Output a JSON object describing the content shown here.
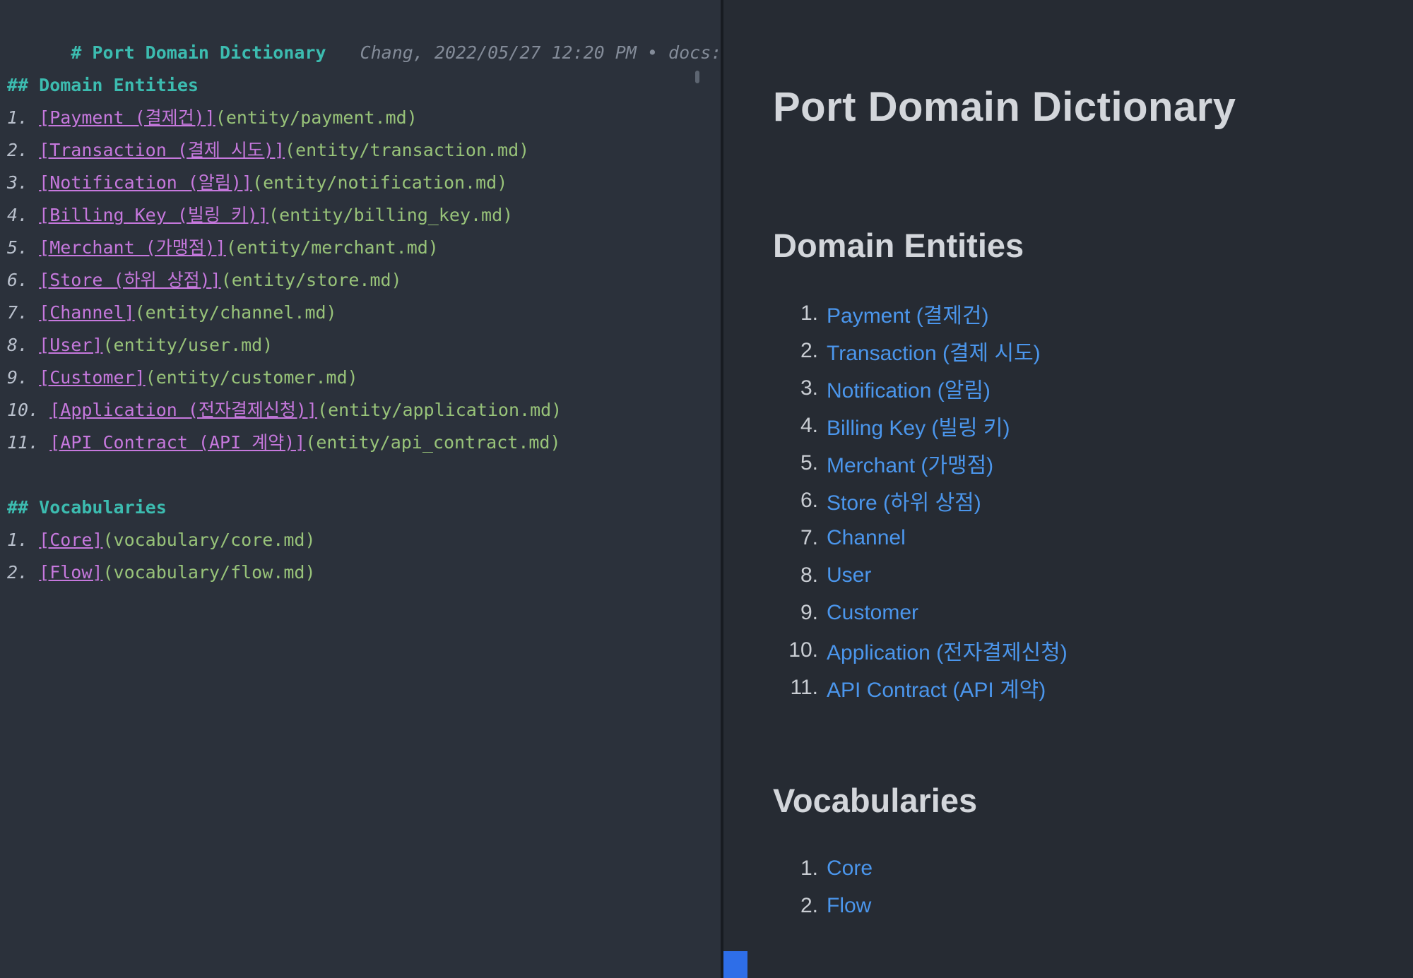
{
  "editor": {
    "title_line": {
      "heading": "# Port Domain Dictionary",
      "meta": "Chang, 2022/05/27 12:20 PM • docs:",
      "check": "✔",
      "trail": "("
    },
    "sections": [
      {
        "heading": "## Domain Entities",
        "items": [
          {
            "num": "1.",
            "link": "[Payment (결제건)]",
            "path": "(entity/payment.md)"
          },
          {
            "num": "2.",
            "link": "[Transaction (결제 시도)]",
            "path": "(entity/transaction.md)"
          },
          {
            "num": "3.",
            "link": "[Notification (알림)]",
            "path": "(entity/notification.md)"
          },
          {
            "num": "4.",
            "link": "[Billing Key (빌링 키)]",
            "path": "(entity/billing_key.md)"
          },
          {
            "num": "5.",
            "link": "[Merchant (가맹점)]",
            "path": "(entity/merchant.md)"
          },
          {
            "num": "6.",
            "link": "[Store (하위 상점)]",
            "path": "(entity/store.md)"
          },
          {
            "num": "7.",
            "link": "[Channel]",
            "path": "(entity/channel.md)"
          },
          {
            "num": "8.",
            "link": "[User]",
            "path": "(entity/user.md)"
          },
          {
            "num": "9.",
            "link": "[Customer]",
            "path": "(entity/customer.md)"
          },
          {
            "num": "10.",
            "link": "[Application (전자결제신청)]",
            "path": "(entity/application.md)"
          },
          {
            "num": "11.",
            "link": "[API Contract (API 계약)]",
            "path": "(entity/api_contract.md)"
          }
        ]
      },
      {
        "heading": "## Vocabularies",
        "items": [
          {
            "num": "1.",
            "link": "[Core]",
            "path": "(vocabulary/core.md)"
          },
          {
            "num": "2.",
            "link": "[Flow]",
            "path": "(vocabulary/flow.md)"
          }
        ]
      }
    ]
  },
  "preview": {
    "title": "Port Domain Dictionary",
    "sections": [
      {
        "heading": "Domain Entities",
        "items": [
          {
            "num": "1.",
            "label": "Payment (결제건)"
          },
          {
            "num": "2.",
            "label": "Transaction (결제 시도)"
          },
          {
            "num": "3.",
            "label": "Notification (알림)"
          },
          {
            "num": "4.",
            "label": "Billing Key (빌링 키)"
          },
          {
            "num": "5.",
            "label": "Merchant (가맹점)"
          },
          {
            "num": "6.",
            "label": "Store (하위 상점)"
          },
          {
            "num": "7.",
            "label": "Channel"
          },
          {
            "num": "8.",
            "label": "User"
          },
          {
            "num": "9.",
            "label": "Customer"
          },
          {
            "num": "10.",
            "label": "Application (전자결제신청)"
          },
          {
            "num": "11.",
            "label": "API Contract (API 계약)"
          }
        ]
      },
      {
        "heading": "Vocabularies",
        "items": [
          {
            "num": "1.",
            "label": "Core"
          },
          {
            "num": "2.",
            "label": "Flow"
          }
        ]
      }
    ]
  },
  "colors": {
    "editor_background": "#2b313b",
    "preview_background": "#262b33",
    "heading_teal": "#3cbcb0",
    "source_link_purple": "#c678dd",
    "source_path_green": "#98c379",
    "meta_gray": "#838b98",
    "check_green": "#2fae47",
    "preview_text": "#d3d6db",
    "preview_link_blue": "#4b96ec",
    "indicator_blue": "#2e6ee8"
  }
}
